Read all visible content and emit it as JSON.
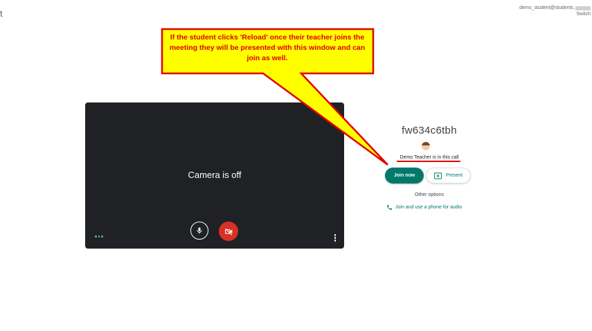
{
  "header": {
    "logo_fragment": "t",
    "account_email": "demo_student@students.",
    "switch_label": "Switch"
  },
  "preview": {
    "camera_status": "Camera is off",
    "mic_icon": "mic-icon",
    "camera_icon": "camera-off-icon"
  },
  "join_panel": {
    "meeting_code": "fw634c6tbh",
    "in_call_text": "Demo Teacher is in this call",
    "join_label": "Join now",
    "present_label": "Present",
    "other_options": "Other options",
    "phone_label": "Join and use a phone for audio"
  },
  "callout": {
    "text": "If the student clicks 'Reload' once their teacher joins the meeting they will be presented with this window and can join as well."
  },
  "colors": {
    "accent": "#00796b",
    "camera_off": "#d93025",
    "callout_fill": "#ffff00",
    "callout_stroke": "#e00000",
    "preview_bg": "#202124"
  }
}
